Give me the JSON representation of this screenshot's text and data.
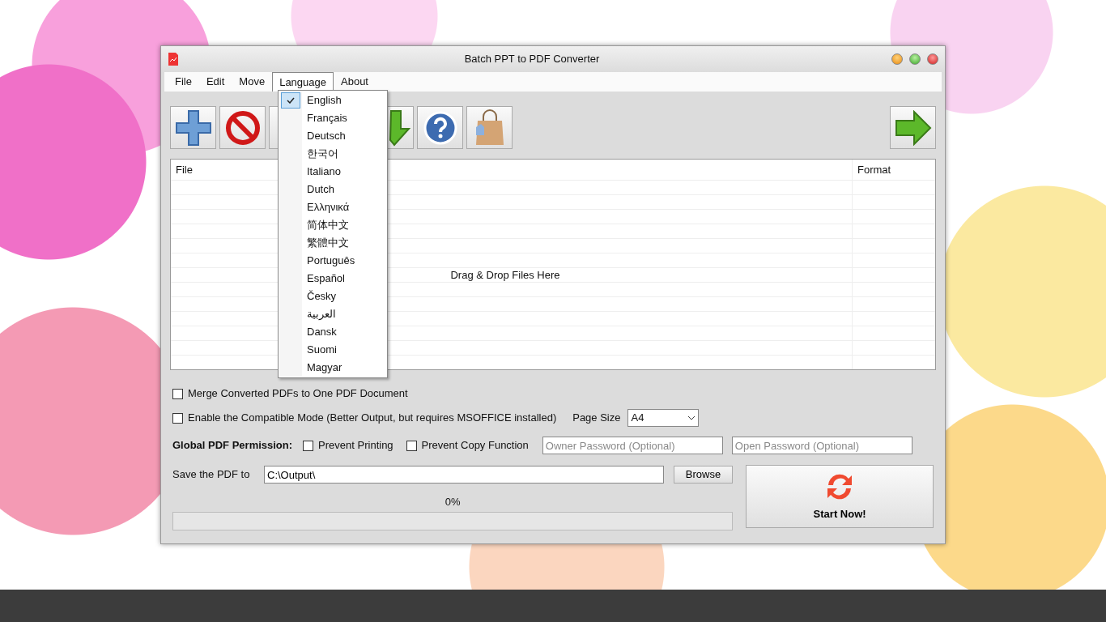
{
  "window": {
    "title": "Batch PPT to PDF Converter"
  },
  "menu_bar": [
    {
      "label": "File",
      "selected": false
    },
    {
      "label": "Edit",
      "selected": false
    },
    {
      "label": "Move",
      "selected": false
    },
    {
      "label": "Language",
      "selected": true
    },
    {
      "label": "About",
      "selected": false
    }
  ],
  "language_menu": [
    {
      "label": "English",
      "checked": true
    },
    {
      "label": "Français",
      "checked": false
    },
    {
      "label": "Deutsch",
      "checked": false
    },
    {
      "label": "한국어",
      "checked": false
    },
    {
      "label": "Italiano",
      "checked": false
    },
    {
      "label": "Dutch",
      "checked": false
    },
    {
      "label": "Ελληνικά",
      "checked": false
    },
    {
      "label": "简体中文",
      "checked": false
    },
    {
      "label": "繁體中文",
      "checked": false
    },
    {
      "label": "Português",
      "checked": false
    },
    {
      "label": "Español",
      "checked": false
    },
    {
      "label": "Česky",
      "checked": false
    },
    {
      "label": "العربية",
      "checked": false
    },
    {
      "label": "Dansk",
      "checked": false
    },
    {
      "label": "Suomi",
      "checked": false
    },
    {
      "label": "Magyar",
      "checked": false
    }
  ],
  "toolbar": [
    {
      "kind": "add"
    },
    {
      "kind": "remove"
    },
    {
      "kind": "covered"
    },
    {
      "kind": "hidden"
    },
    {
      "kind": "down"
    },
    {
      "kind": "help"
    },
    {
      "kind": "shop"
    }
  ],
  "next_button": {
    "kind": "next"
  },
  "table": {
    "columns": [
      "File",
      "Format"
    ],
    "empty_message": "Drag & Drop Files Here"
  },
  "options": [
    {
      "label": "Merge Converted PDFs to One PDF Document",
      "checked": false
    },
    {
      "label": "Enable the Compatible Mode (Better Output, but requires MSOFFICE installed)",
      "checked": false
    }
  ],
  "page_size": {
    "label": "Page Size",
    "value": "A4"
  },
  "permission": {
    "label": "Global PDF Permission:",
    "options": [
      {
        "label": "Prevent Printing",
        "checked": false
      },
      {
        "label": "Prevent Copy Function",
        "checked": false
      }
    ],
    "owner_password": {
      "placeholder": "Owner Password (Optional)"
    },
    "open_password": {
      "placeholder": "Open Password (Optional)"
    }
  },
  "output": {
    "label": "Save the PDF to",
    "value": "C:\\Output\\",
    "browse": "Browse"
  },
  "progress": {
    "reading": "0%",
    "level": 0
  },
  "start_button": {
    "label": "Start Now!"
  }
}
